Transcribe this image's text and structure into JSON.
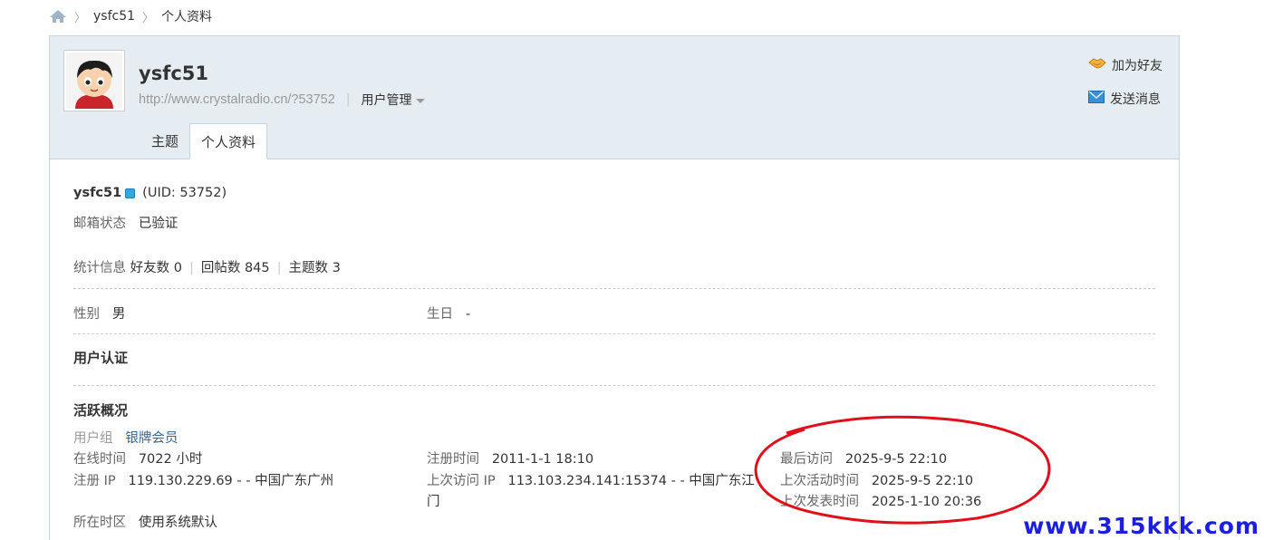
{
  "breadcrumb": {
    "user": "ysfc51",
    "page": "个人资料"
  },
  "header": {
    "username": "ysfc51",
    "url": "http://www.crystalradio.cn/?53752",
    "manage_label": "用户管理",
    "add_friend": "加为好友",
    "send_message": "发送消息"
  },
  "tabs": [
    {
      "label": "主题"
    },
    {
      "label": "个人资料"
    }
  ],
  "profile": {
    "name": "ysfc51",
    "uid": "(UID: 53752)",
    "email_label": "邮箱状态",
    "email_value": "已验证",
    "stats_label": "统计信息",
    "friends": "好友数 0",
    "replies": "回帖数 845",
    "topics": "主题数 3",
    "gender_label": "性别",
    "gender_value": "男",
    "birthday_label": "生日",
    "birthday_value": "-"
  },
  "sections": {
    "verification": "用户认证",
    "activity": "活跃概况"
  },
  "activity": {
    "group_label": "用户组",
    "group_value": "银牌会员",
    "online_label": "在线时间",
    "online_value": "7022 小时",
    "reg_ip_label": "注册 IP",
    "reg_ip_value": "119.130.229.69 - - 中国广东广州",
    "timezone_label": "所在时区",
    "timezone_value": "使用系统默认",
    "reg_time_label": "注册时间",
    "reg_time_value": "2011-1-1 18:10",
    "last_ip_label": "上次访问 IP",
    "last_ip_value_line1": "113.103.234.141:15374 - - 中国广东江",
    "last_ip_value_line2": "门",
    "last_visit_label": "最后访问",
    "last_visit_value": "2025-9-5 22:10",
    "last_active_label": "上次活动时间",
    "last_active_value": "2025-9-5 22:10",
    "last_post_label": "上次发表时间",
    "last_post_value": "2025-1-10 20:36"
  },
  "watermark": "www.315kkk.com",
  "colors": {
    "header_bg": "#e5edf2",
    "border": "#c2d5e3",
    "annotation": "#e0101a",
    "watermark": "#1a1fe0"
  },
  "icons": [
    "home-icon",
    "handshake-icon",
    "envelope-icon",
    "vip-icon",
    "chevron-down-icon"
  ]
}
